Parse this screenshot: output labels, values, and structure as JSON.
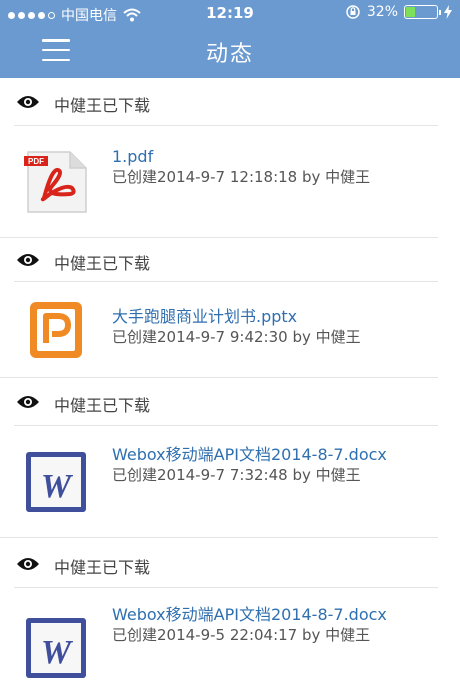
{
  "status_bar": {
    "carrier": "中国电信",
    "time": "12:19",
    "battery": "32%",
    "battery_level": 0.32
  },
  "nav": {
    "title": "动态",
    "menu_icon": "hamburger-icon"
  },
  "activities": [
    {
      "action": "中健王已下载",
      "file_icon": "pdf-file-icon",
      "file_name": "1.pdf",
      "meta": "已创建2014-9-7 12:18:18 by 中健王"
    },
    {
      "action": "中健王已下载",
      "file_icon": "pptx-file-icon",
      "file_name": "大手跑腿商业计划书.pptx",
      "meta": "已创建2014-9-7 9:42:30 by 中健王"
    },
    {
      "action": "中健王已下载",
      "file_icon": "docx-file-icon",
      "file_name": "Webox移动端API文档2014-8-7.docx",
      "meta": "已创建2014-9-7 7:32:48 by 中健王"
    },
    {
      "action": "中健王已下载",
      "file_icon": "docx-file-icon",
      "file_name": "Webox移动端API文档2014-8-7.docx",
      "meta": "已创建2014-9-5 22:04:17 by 中健王"
    }
  ]
}
